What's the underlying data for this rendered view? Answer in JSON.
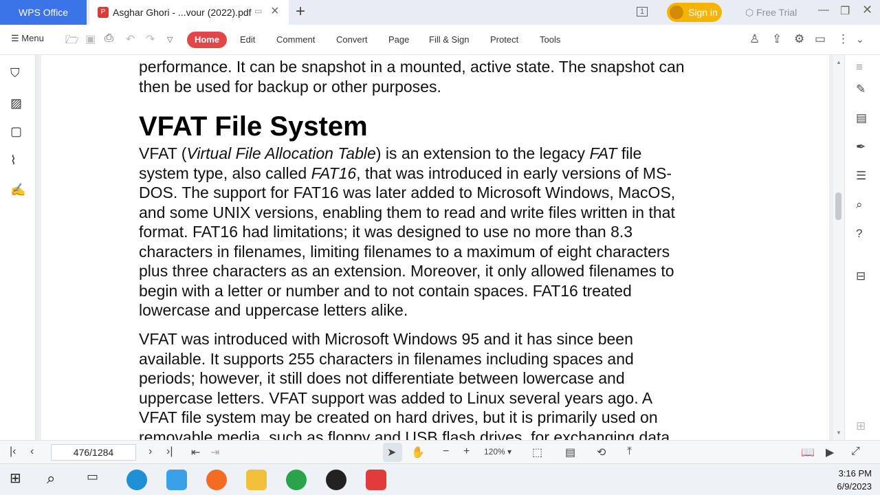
{
  "titlebar": {
    "app_tab": "WPS Office",
    "doc_tab": "Asghar Ghori - ...vour (2022).pdf",
    "signin": "Sign in",
    "free_trial": "Free Trial",
    "page_badge": "1"
  },
  "toolbar": {
    "menu": "Menu",
    "tabs": [
      "Home",
      "Edit",
      "Comment",
      "Convert",
      "Page",
      "Fill & Sign",
      "Protect",
      "Tools"
    ],
    "active_tab": "Home"
  },
  "document": {
    "para0_line1": "performance. It can be snapshot in a mounted, active state. The snapshot can",
    "para0_line2": "then be used for backup or other purposes.",
    "heading": "VFAT File System",
    "para1": {
      "l1a": "VFAT (",
      "l1b": "Virtual File Allocation Table",
      "l1c": ") is an extension to the legacy ",
      "l1d": "FAT",
      "l1e": " file",
      "l2a": "system type, also called ",
      "l2b": "FAT16",
      "l2c": ", that was introduced in early versions of MS-",
      "l3": "DOS. The support for FAT16 was later added to Microsoft Windows, MacOS,",
      "l4": "and some UNIX versions, enabling them to read and write files written in that",
      "l5": "format. FAT16 had limitations; it was designed to use no more than 8.3",
      "l6": "characters in filenames, limiting filenames to a maximum of eight characters",
      "l7": "plus three characters as an extension. Moreover, it only allowed filenames to",
      "l8": "begin with a letter or number and to not contain spaces. FAT16 treated",
      "l9": "lowercase and uppercase letters alike."
    },
    "para2": {
      "l1": "VFAT was introduced with Microsoft Windows 95 and it has since been",
      "l2": "available. It supports 255 characters in filenames including spaces and",
      "l3": "periods; however, it still does not differentiate between lowercase and",
      "l4": "uppercase letters. VFAT support was added to Linux several years ago. A",
      "l5": "VFAT file system may be created on hard drives, but it is primarily used on",
      "l6": "removable media, such as floppy and USB flash drives, for exchanging data"
    }
  },
  "statusbar": {
    "page_indicator": "476/1284",
    "zoom": "120%"
  },
  "taskbar": {
    "time": "3:16 PM",
    "date": "6/9/2023"
  },
  "colors": {
    "accent": "#3b73e8",
    "home_tab": "#e24747",
    "signin": "#f4b400"
  }
}
